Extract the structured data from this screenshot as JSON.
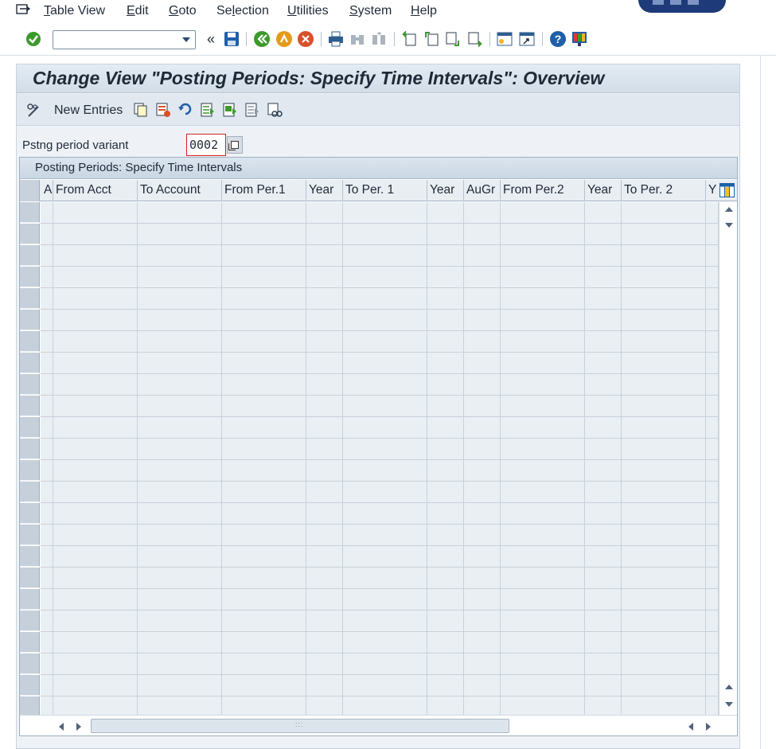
{
  "menu": {
    "items": [
      "Table View",
      "Edit",
      "Goto",
      "Selection",
      "Utilities",
      "System",
      "Help"
    ],
    "underline": [
      "T",
      "E",
      "G",
      "l",
      "U",
      "S",
      "H"
    ]
  },
  "toolbar": {
    "command_value": "",
    "icons": [
      "enter-icon",
      "save-icon",
      "back-icon",
      "exit-icon",
      "cancel-icon",
      "print-icon",
      "find-icon",
      "find-next-icon",
      "first-page-icon",
      "previous-page-icon",
      "next-page-icon",
      "last-page-icon",
      "create-session-icon",
      "shortcut-icon",
      "help-icon",
      "customize-layout-icon"
    ]
  },
  "screen": {
    "title": "Change View \"Posting Periods: Specify Time Intervals\": Overview",
    "new_entries_label": "New Entries"
  },
  "variant": {
    "label": "Pstng period variant",
    "value": "0002"
  },
  "table": {
    "title": "Posting Periods: Specify Time Intervals",
    "columns": [
      "A",
      "From Acct",
      "To Account",
      "From Per.1",
      "Year",
      "To Per. 1",
      "Year",
      "AuGr",
      "From Per.2",
      "Year",
      "To Per. 2",
      "Y"
    ],
    "row_count": 24
  },
  "colors": {
    "accent": "#1e3a78",
    "cell_bg": "#eaeff4",
    "header_bg": "#e9eef3",
    "ok_green": "#3c9a2a",
    "cancel_red": "#d8502a",
    "back_orange": "#e39b1c"
  }
}
